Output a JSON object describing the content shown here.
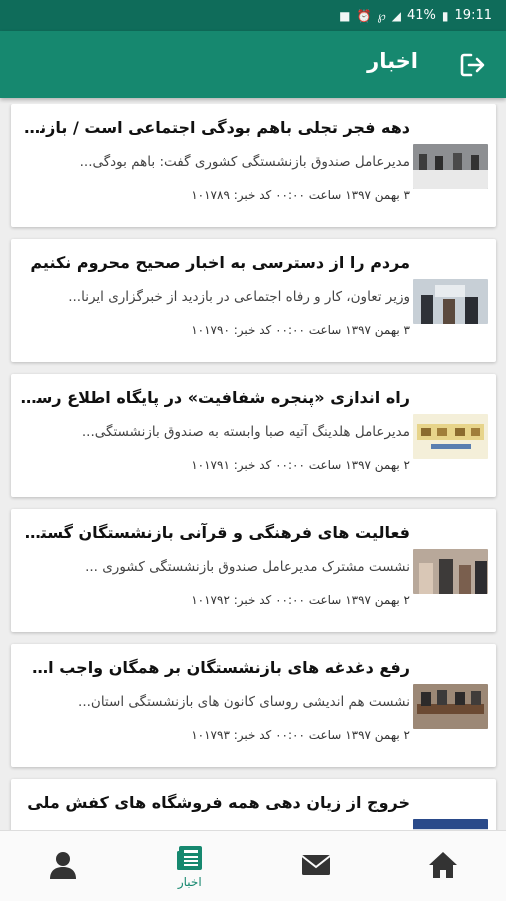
{
  "status_bar": {
    "battery": "41%",
    "time": "19:11"
  },
  "app_bar": {
    "title": "اخبار",
    "logout_icon": "logout-icon"
  },
  "news": [
    {
      "title": "دهه فجر تجلی باهم بودگی اجتماعی است / بازنشستگان...",
      "summary": "مدیرعامل صندوق بازنشستگی کشوری گفت: باهم بودگی...",
      "meta": "۳ بهمن ۱۳۹۷ ساعت ۰۰:۰۰   کد خبر: ۱۰۱۷۸۹"
    },
    {
      "title": "مردم را از دسترسی به اخبار صحیح محروم نکنیم",
      "summary": "وزیر تعاون، کار و رفاه اجتماعی در بازدید از خبرگزاری ایرنا...",
      "meta": "۳ بهمن ۱۳۹۷ ساعت ۰۰:۰۰   کد خبر: ۱۰۱۷۹۰"
    },
    {
      "title": "راه اندازی «پنجره شفافیت» در پایگاه اطلاع رسانی...",
      "summary": "مدیرعامل هلدینگ آتیه صبا وابسته به صندوق بازنشستگی...",
      "meta": "۲ بهمن ۱۳۹۷ ساعت ۰۰:۰۰   کد خبر: ۱۰۱۷۹۱"
    },
    {
      "title": "فعالیت های فرهنگی و قرآنی بازنشستگان گسترش...",
      "summary": "نشست مشترک مدیرعامل صندوق بازنشستگی کشوری ...",
      "meta": "۲ بهمن ۱۳۹۷ ساعت ۰۰:۰۰   کد خبر: ۱۰۱۷۹۲"
    },
    {
      "title": "رفع دغدغه های بازنشستگان بر همگان واجب است",
      "summary": "نشست هم اندیشی روسای کانون های بازنشستگی استان...",
      "meta": "۲ بهمن ۱۳۹۷ ساعت ۰۰:۰۰   کد خبر: ۱۰۱۷۹۳"
    },
    {
      "title": "خروج از زیان دهی همه فروشگاه های کفش ملی",
      "summary": "",
      "meta": ""
    }
  ],
  "bottom_nav": {
    "items": [
      {
        "icon": "home-icon",
        "label": ""
      },
      {
        "icon": "mail-icon",
        "label": ""
      },
      {
        "icon": "news-icon",
        "label": "اخبار"
      },
      {
        "icon": "profile-icon",
        "label": ""
      }
    ],
    "active_color": "#16886f"
  },
  "colors": {
    "status_bar": "#0f6c5a",
    "app_bar": "#16886f"
  }
}
